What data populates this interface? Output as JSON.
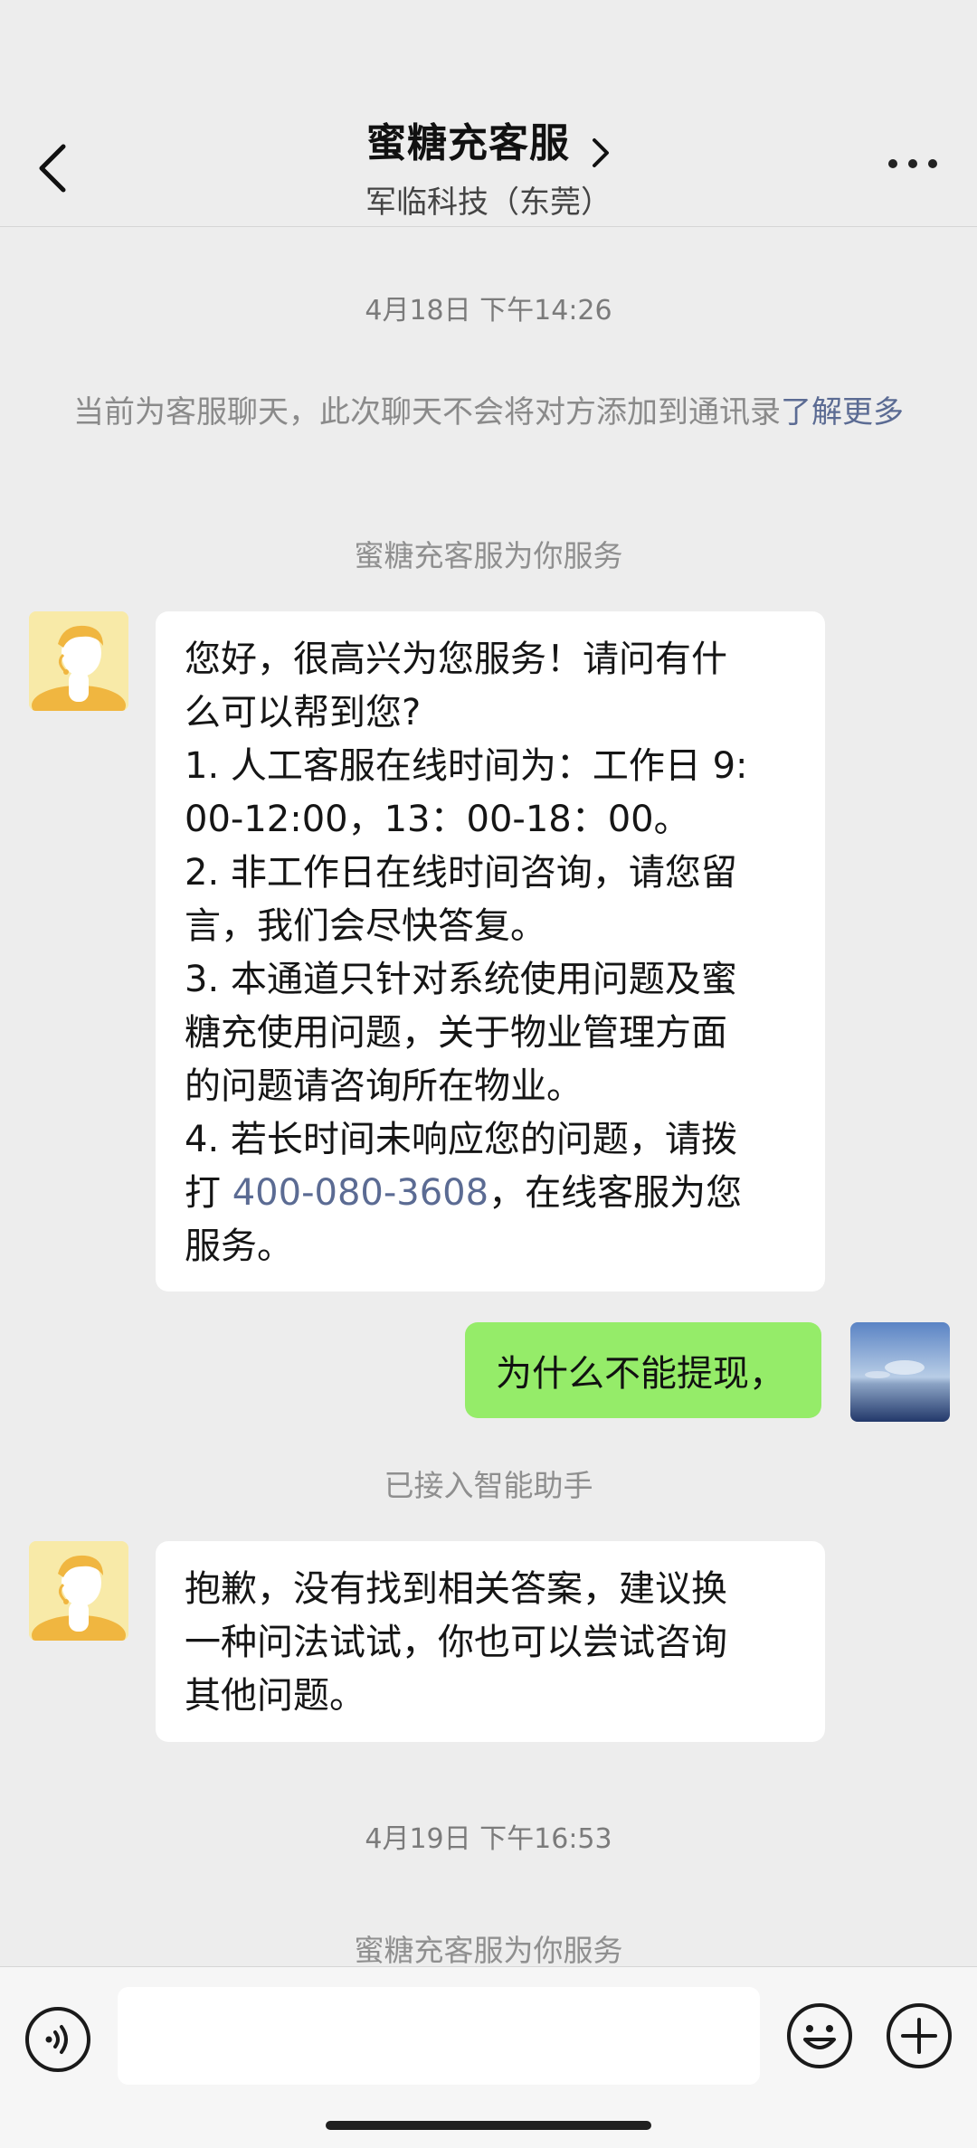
{
  "header": {
    "title": "蜜糖充客服",
    "subtitle": "军临科技（东莞）",
    "back_icon": "chevron-left-icon",
    "more_icon": "more-dots-icon"
  },
  "messages": {
    "timestamp1": "4月18日 下午14:26",
    "notice_text": "当前为客服聊天，此次聊天不会将对方添加到通讯录",
    "notice_link": "了解更多",
    "system1": "蜜糖充客服为你服务",
    "bot_message1": {
      "lines": [
        "您好，很高兴为您服务！请问有什",
        "么可以帮到您?",
        "1. 人工客服在线时间为：工作日 9:",
        "00-12:00，13：00-18：00。",
        "2. 非工作日在线时间咨询，请您留",
        "言，我们会尽快答复。",
        "3. 本通道只针对系统使用问题及蜜",
        "糖充使用问题，关于物业管理方面",
        "的问题请咨询所在物业。",
        "4. 若长时间未响应您的问题，请拨"
      ],
      "line11_prefix": "打 ",
      "phone": "400-080-3608",
      "line11_suffix": "，在线客服为您",
      "line12": "服务。"
    },
    "user_message": "为什么不能提现，",
    "system2": "已接入智能助手",
    "bot_message2": {
      "lines": [
        "抱歉，没有找到相关答案，建议换",
        "一种问法试试，你也可以尝试咨询",
        "其他问题。"
      ]
    },
    "timestamp2": "4月19日 下午16:53",
    "system3": "蜜糖充客服为你服务"
  },
  "input_bar": {
    "voice_icon": "voice-icon",
    "emoji_icon": "emoji-icon",
    "plus_icon": "plus-icon",
    "input_value": ""
  }
}
